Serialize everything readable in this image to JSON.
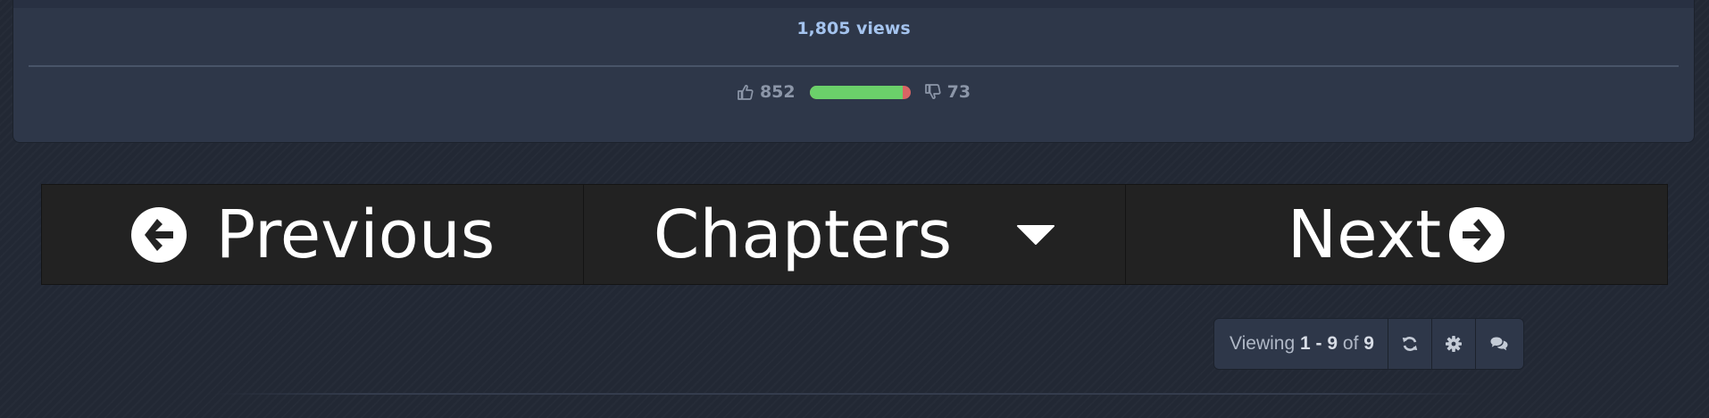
{
  "stats": {
    "views_text": "1,805 views",
    "likes": "852",
    "dislikes": "73",
    "like_ratio": 0.92,
    "colors": {
      "like": "#6bd06a",
      "dislike": "#d86464"
    }
  },
  "nav": {
    "previous_label": "Previous",
    "chapters_label": "Chapters",
    "next_label": "Next"
  },
  "viewing": {
    "prefix": "Viewing",
    "start": "1",
    "separator": "-",
    "end": "9",
    "of": "of",
    "total": "9"
  },
  "icons": {
    "thumbs_up": "thumbs-up-icon",
    "thumbs_down": "thumbs-down-icon",
    "previous": "arrow-circle-left-icon",
    "chapters": "caret-down-icon",
    "next": "arrow-circle-right-icon",
    "refresh": "refresh-icon",
    "settings": "gear-icon",
    "comments": "comments-icon"
  }
}
